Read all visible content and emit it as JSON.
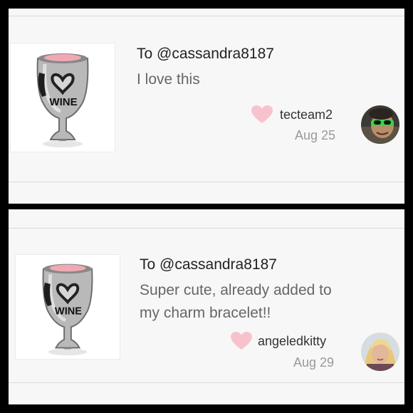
{
  "comments": [
    {
      "recipient": "To @cassandra8187",
      "message_lines": [
        "I love this"
      ],
      "username": "tecteam2",
      "date": "Aug 25",
      "avatar": "user-avatar-sunglasses",
      "product_image": "wine-glass-charm",
      "product_label": "WINE"
    },
    {
      "recipient": "To @cassandra8187",
      "message_lines": [
        "Super cute, already added to",
        "my charm bracelet!!"
      ],
      "username": "angeledkitty",
      "date": "Aug 29",
      "avatar": "user-avatar-blonde",
      "product_image": "wine-glass-charm",
      "product_label": "WINE"
    }
  ],
  "colors": {
    "heart": "#f8c2cc",
    "card_bg": "#f8f7f7",
    "frame": "#000000"
  }
}
